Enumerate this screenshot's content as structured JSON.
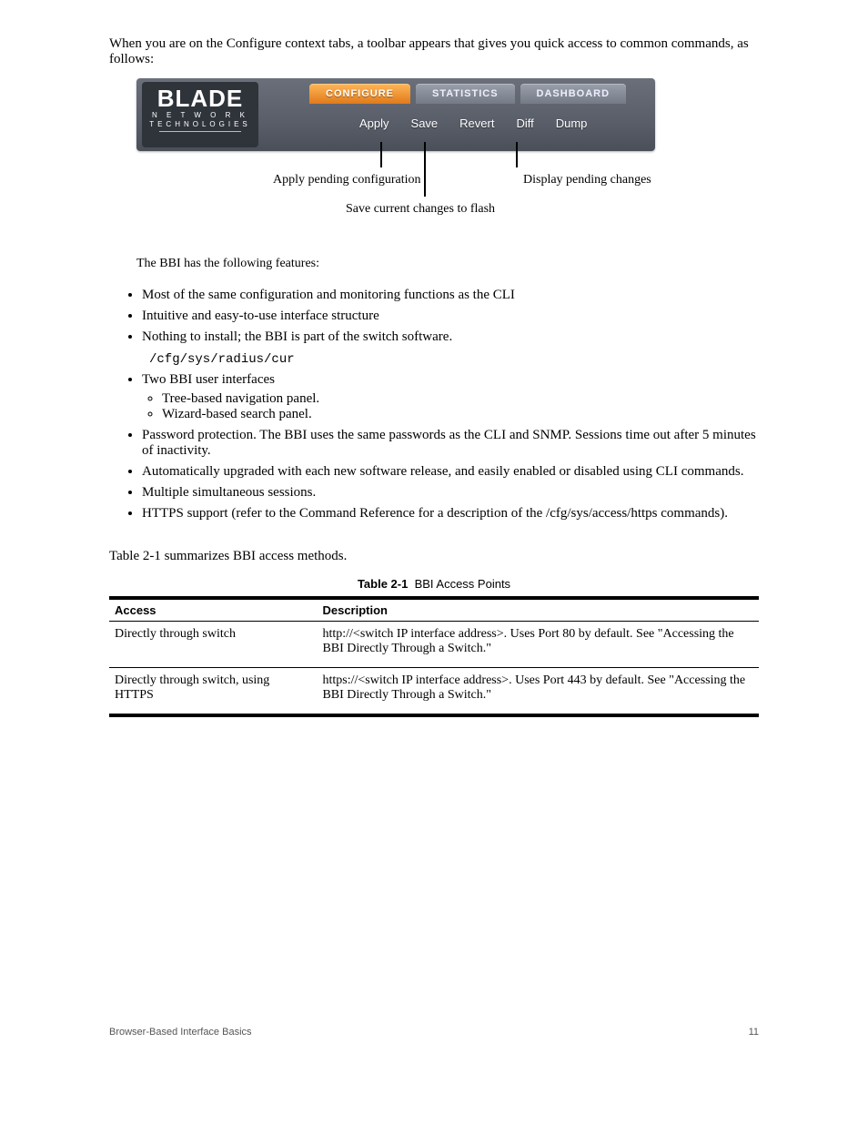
{
  "intro": "When you are on the Configure context tabs, a toolbar appears that gives you quick access to common commands, as follows:",
  "banner": {
    "logo_main": "BLADE",
    "logo_sub1": "N E T W O R K",
    "logo_sub2": "TECHNOLOGIES",
    "tabs": [
      {
        "label": "CONFIGURE",
        "active": true
      },
      {
        "label": "STATISTICS",
        "active": false
      },
      {
        "label": "DASHBOARD",
        "active": false
      }
    ],
    "toolbar": [
      "Apply",
      "Save",
      "Revert",
      "Diff",
      "Dump"
    ]
  },
  "callouts": {
    "apply": "Apply pending configuration",
    "save": "Save current changes to flash",
    "diff": "Display pending changes"
  },
  "features_intro": "The BBI has the following features:",
  "bullets": [
    "Most of the same configuration and monitoring functions as the CLI",
    "Intuitive and easy-to-use interface structure",
    "Nothing to install; the BBI is part of the switch software.",
    "Two BBI user interfaces"
  ],
  "code_line": "/cfg/sys/radius/cur",
  "sub_bullets": [
    "Tree-based navigation panel.",
    "Wizard-based search panel."
  ],
  "bullets_after": [
    "Password protection. The BBI uses the same passwords as the CLI and SNMP. Sessions time out after 5 minutes of inactivity.",
    "Automatically upgraded with each new software release, and easily enabled or disabled using CLI commands.",
    "Multiple simultaneous sessions.",
    "HTTPS support (refer to the Command Reference for a description of the /cfg/sys/access/https commands)."
  ],
  "table": {
    "caption_bold": "Table 2-1",
    "caption_rest": "summarizes BBI access methods.",
    "header_caption": "BBI Access Points",
    "cols": [
      "Access",
      "Description"
    ],
    "rows": [
      {
        "access": "Directly through switch",
        "desc": "http://<switch IP interface address>. Uses Port 80 by default. See \"Accessing the BBI Directly Through a Switch.\""
      },
      {
        "access": "Directly through switch, using HTTPS",
        "desc": "https://<switch IP interface address>. Uses Port 443 by default. See \"Accessing the BBI Directly Through a Switch.\""
      }
    ]
  },
  "footer": {
    "left": "Browser-Based Interface Basics",
    "right": "11"
  }
}
